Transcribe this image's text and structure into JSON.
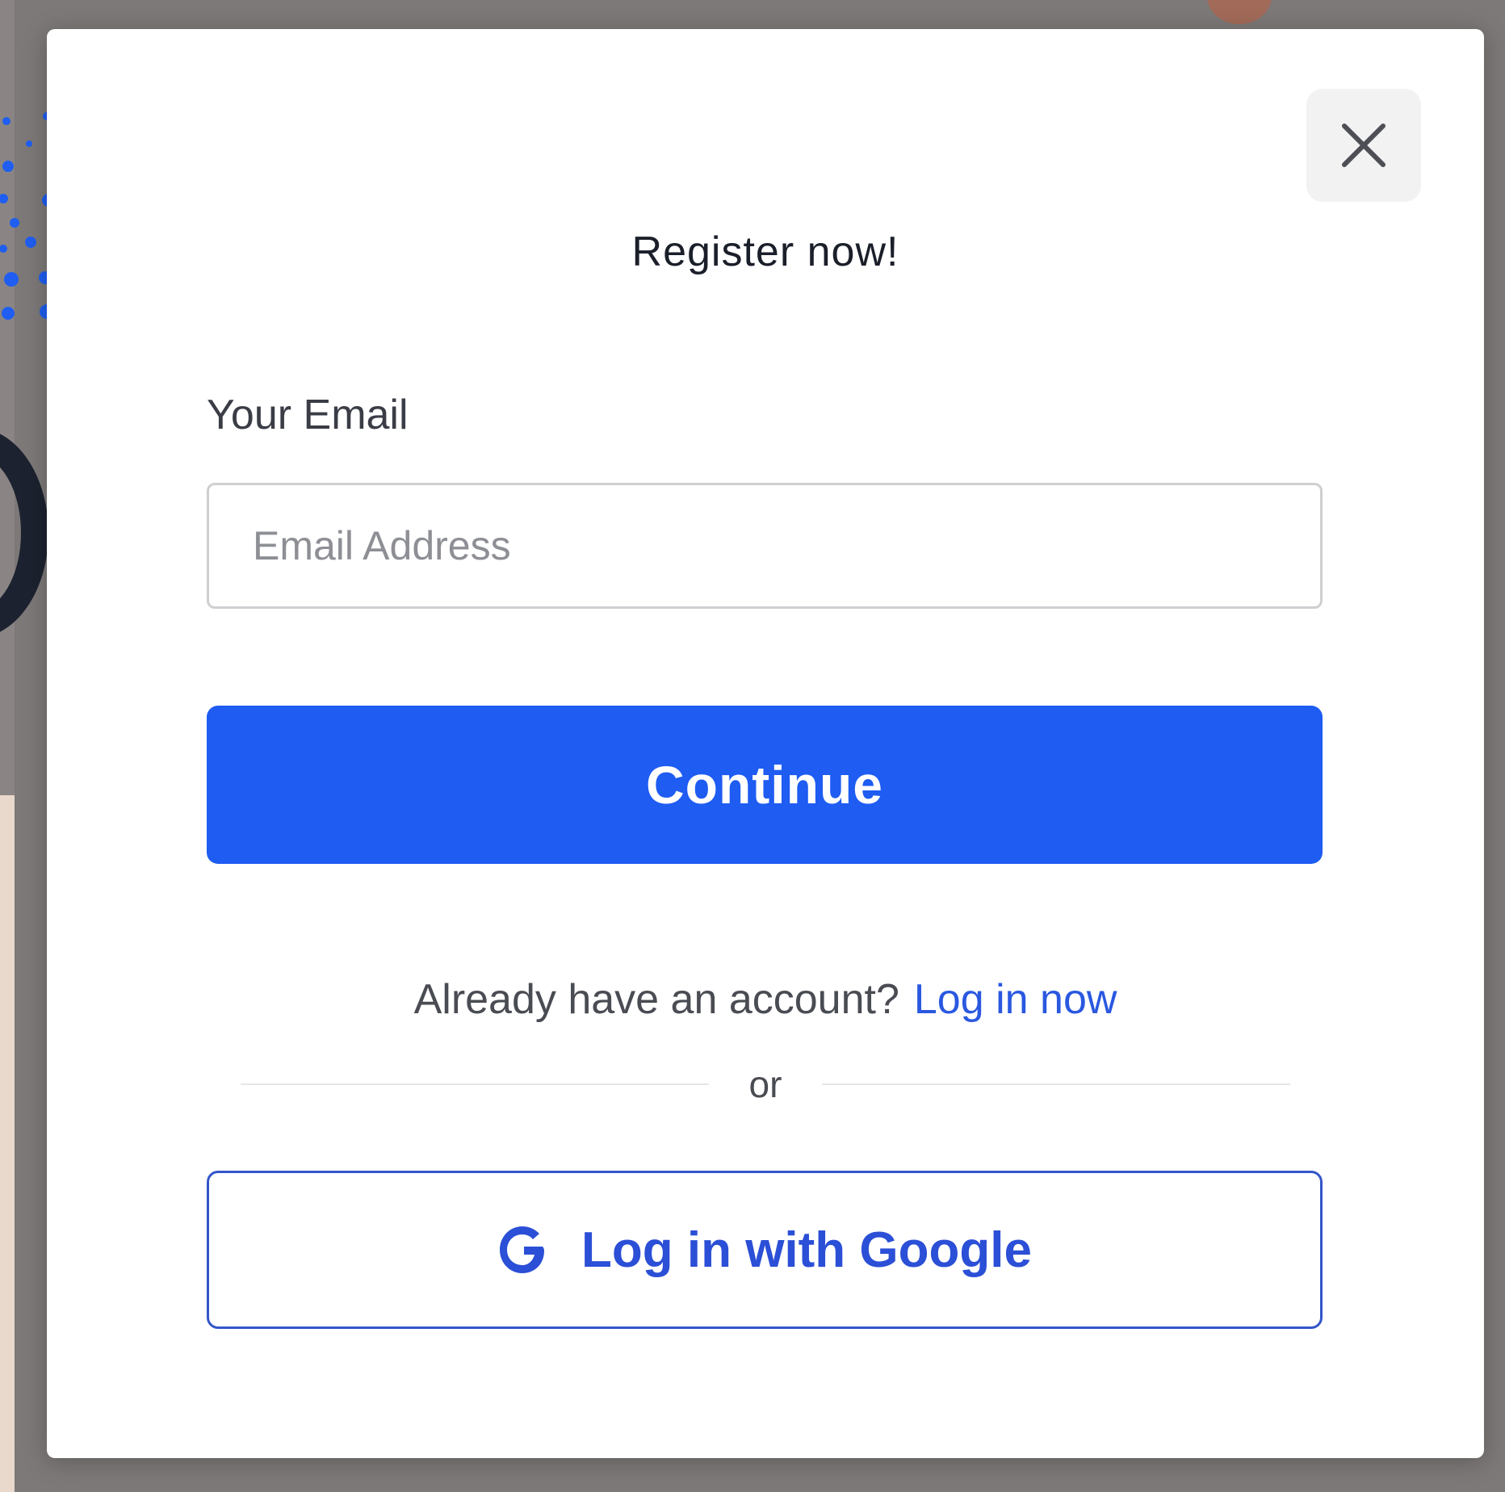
{
  "modal": {
    "title": "Register now!",
    "close_icon": "close-icon"
  },
  "email": {
    "label": "Your Email",
    "placeholder": "Email Address",
    "value": ""
  },
  "continue": {
    "label": "Continue"
  },
  "account": {
    "prompt": "Already have an account?",
    "login_link": "Log in now"
  },
  "divider": {
    "text": "or"
  },
  "google": {
    "label": "Log in with Google",
    "icon": "google-g-icon"
  },
  "colors": {
    "primary": "#1e5cf2",
    "link": "#2a58e0",
    "google_text": "#2b4fd6",
    "backdrop": "#7d7978"
  }
}
